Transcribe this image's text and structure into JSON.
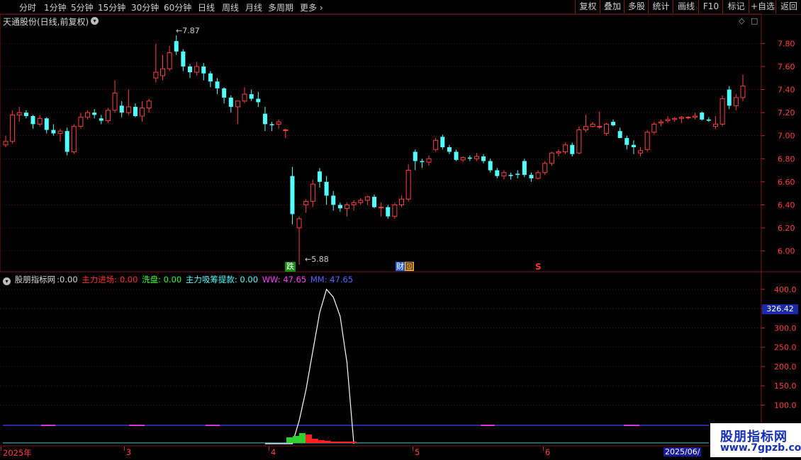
{
  "toolbar": {
    "periods": [
      "分时",
      "1分钟",
      "5分钟",
      "15分钟",
      "30分钟",
      "60分钟",
      "日线",
      "周线",
      "月线",
      "多周期",
      "更多"
    ],
    "more_icon": "chevron-right-icon",
    "buttons": [
      "复权",
      "叠加",
      "多股",
      "统计",
      "画线",
      "F10",
      "标记",
      "+自选",
      "返回"
    ]
  },
  "stock": {
    "title": "天通股份(日线,前复权)"
  },
  "price_axis": {
    "ticks": [
      "7.80",
      "7.60",
      "7.40",
      "7.20",
      "7.00",
      "6.80",
      "6.60",
      "6.40",
      "6.20",
      "6.00"
    ]
  },
  "annotations": {
    "high": "7.87",
    "low": "5.88"
  },
  "markers": {
    "die": "跌",
    "cai": "财",
    "hui": "回",
    "s": "S"
  },
  "indicator": {
    "name": "股朋指标网",
    "main_label": ":0.00",
    "zljc": "主力进场: 0.00",
    "xp": "洗盘: 0.00",
    "zltk": "主力吸筹提款: 0.00",
    "ww": "WW: 47.65",
    "mm": "MM: 47.65"
  },
  "ind_axis": {
    "ticks": [
      "400.0",
      "350.0",
      "300.0",
      "250.0",
      "200.0",
      "150.0",
      "100.0"
    ],
    "current": "326.42"
  },
  "x_axis": {
    "labels": [
      "2025年",
      "3",
      "4",
      "5",
      "6"
    ],
    "current_date": "2025/06/"
  },
  "watermark": {
    "main": "股朋指标网",
    "url": "www.7gpzb.com"
  },
  "colors": {
    "up": "#ff4040",
    "down": "#54ffff",
    "grid": "#7a1a1a",
    "ww": "#ff40ff",
    "mm": "#4040ff"
  },
  "chart_data": {
    "type": "candlestick",
    "ohlc": [
      [
        6.92,
        7.0,
        6.9,
        6.95
      ],
      [
        6.95,
        7.22,
        6.93,
        7.18
      ],
      [
        7.18,
        7.25,
        7.12,
        7.2
      ],
      [
        7.2,
        7.22,
        7.15,
        7.17
      ],
      [
        7.17,
        7.18,
        7.06,
        7.1
      ],
      [
        7.1,
        7.18,
        7.08,
        7.15
      ],
      [
        7.15,
        7.16,
        7.02,
        7.05
      ],
      [
        7.05,
        7.1,
        7.0,
        7.02
      ],
      [
        7.02,
        7.06,
        6.95,
        7.04
      ],
      [
        7.04,
        7.07,
        6.83,
        6.86
      ],
      [
        6.86,
        7.1,
        6.84,
        7.08
      ],
      [
        7.08,
        7.2,
        7.06,
        7.16
      ],
      [
        7.16,
        7.22,
        7.14,
        7.2
      ],
      [
        7.2,
        7.23,
        7.15,
        7.18
      ],
      [
        7.15,
        7.18,
        7.1,
        7.13
      ],
      [
        7.13,
        7.24,
        7.11,
        7.22
      ],
      [
        7.22,
        7.48,
        7.2,
        7.37
      ],
      [
        7.26,
        7.3,
        7.16,
        7.2
      ],
      [
        7.2,
        7.4,
        7.18,
        7.25
      ],
      [
        7.25,
        7.28,
        7.16,
        7.17
      ],
      [
        7.17,
        7.3,
        7.12,
        7.24
      ],
      [
        7.24,
        7.32,
        7.2,
        7.3
      ],
      [
        7.5,
        7.8,
        7.46,
        7.55
      ],
      [
        7.52,
        7.7,
        7.48,
        7.58
      ],
      [
        7.58,
        7.78,
        7.56,
        7.72
      ],
      [
        7.82,
        7.87,
        7.7,
        7.73
      ],
      [
        7.73,
        7.75,
        7.56,
        7.6
      ],
      [
        7.6,
        7.62,
        7.5,
        7.55
      ],
      [
        7.55,
        7.64,
        7.52,
        7.6
      ],
      [
        7.6,
        7.63,
        7.48,
        7.54
      ],
      [
        7.54,
        7.56,
        7.42,
        7.47
      ],
      [
        7.47,
        7.5,
        7.36,
        7.41
      ],
      [
        7.41,
        7.42,
        7.28,
        7.33
      ],
      [
        7.33,
        7.35,
        7.2,
        7.25
      ],
      [
        7.25,
        7.28,
        7.1,
        7.3
      ],
      [
        7.3,
        7.42,
        7.28,
        7.36
      ],
      [
        7.36,
        7.4,
        7.3,
        7.32
      ],
      [
        7.32,
        7.38,
        7.25,
        7.29
      ],
      [
        7.19,
        7.25,
        7.04,
        7.1
      ],
      [
        7.1,
        7.12,
        7.04,
        7.09
      ],
      [
        7.1,
        7.14,
        7.06,
        7.12
      ],
      [
        7.05,
        7.06,
        6.98,
        7.05
      ],
      [
        6.65,
        6.73,
        6.23,
        6.32
      ],
      [
        6.2,
        6.3,
        5.88,
        6.28
      ],
      [
        6.4,
        6.45,
        6.33,
        6.43
      ],
      [
        6.43,
        6.62,
        6.38,
        6.58
      ],
      [
        6.69,
        6.72,
        6.55,
        6.6
      ],
      [
        6.6,
        6.65,
        6.4,
        6.48
      ],
      [
        6.48,
        6.52,
        6.35,
        6.4
      ],
      [
        6.4,
        6.42,
        6.34,
        6.37
      ],
      [
        6.37,
        6.42,
        6.3,
        6.4
      ],
      [
        6.4,
        6.44,
        6.35,
        6.42
      ],
      [
        6.42,
        6.46,
        6.4,
        6.44
      ],
      [
        6.44,
        6.48,
        6.4,
        6.47
      ],
      [
        6.47,
        6.49,
        6.37,
        6.38
      ],
      [
        6.38,
        6.42,
        6.3,
        6.38
      ],
      [
        6.38,
        6.4,
        6.28,
        6.3
      ],
      [
        6.3,
        6.42,
        6.28,
        6.4
      ],
      [
        6.4,
        6.48,
        6.38,
        6.45
      ],
      [
        6.45,
        6.75,
        6.43,
        6.7
      ],
      [
        6.86,
        6.88,
        6.7,
        6.78
      ],
      [
        6.78,
        6.8,
        6.72,
        6.77
      ],
      [
        6.77,
        6.83,
        6.74,
        6.8
      ],
      [
        6.88,
        6.98,
        6.86,
        6.96
      ],
      [
        6.99,
        7.01,
        6.88,
        6.9
      ],
      [
        6.9,
        6.92,
        6.84,
        6.86
      ],
      [
        6.86,
        6.88,
        6.78,
        6.79
      ],
      [
        6.79,
        6.82,
        6.77,
        6.81
      ],
      [
        6.81,
        6.83,
        6.78,
        6.8
      ],
      [
        6.8,
        6.85,
        6.78,
        6.82
      ],
      [
        6.82,
        6.84,
        6.76,
        6.78
      ],
      [
        6.78,
        6.8,
        6.68,
        6.7
      ],
      [
        6.7,
        6.72,
        6.63,
        6.65
      ],
      [
        6.65,
        6.7,
        6.62,
        6.68
      ],
      [
        6.66,
        6.68,
        6.62,
        6.65
      ],
      [
        6.67,
        6.7,
        6.63,
        6.66
      ],
      [
        6.78,
        6.8,
        6.64,
        6.66
      ],
      [
        6.66,
        6.68,
        6.6,
        6.63
      ],
      [
        6.63,
        6.7,
        6.62,
        6.68
      ],
      [
        6.68,
        6.78,
        6.66,
        6.76
      ],
      [
        6.76,
        6.86,
        6.74,
        6.85
      ],
      [
        6.85,
        6.88,
        6.82,
        6.86
      ],
      [
        6.86,
        6.94,
        6.84,
        6.92
      ],
      [
        6.92,
        6.94,
        6.82,
        6.84
      ],
      [
        6.85,
        7.08,
        6.84,
        7.05
      ],
      [
        7.05,
        7.18,
        7.03,
        7.08
      ],
      [
        7.08,
        7.12,
        7.07,
        7.1
      ],
      [
        7.08,
        7.21,
        7.06,
        7.08
      ],
      [
        7.02,
        7.11,
        7.0,
        7.1
      ],
      [
        7.12,
        7.14,
        7.08,
        7.09
      ],
      [
        7.04,
        7.07,
        6.98,
        6.98
      ],
      [
        6.98,
        7.0,
        6.88,
        6.92
      ],
      [
        6.92,
        6.96,
        6.84,
        6.9
      ],
      [
        6.85,
        6.9,
        6.82,
        6.87
      ],
      [
        6.88,
        7.05,
        6.86,
        7.03
      ],
      [
        7.03,
        7.12,
        7.01,
        7.1
      ],
      [
        7.11,
        7.14,
        7.08,
        7.12
      ],
      [
        7.13,
        7.17,
        7.11,
        7.14
      ],
      [
        7.14,
        7.16,
        7.12,
        7.15
      ],
      [
        7.15,
        7.17,
        7.11,
        7.16
      ],
      [
        7.16,
        7.17,
        7.14,
        7.16
      ],
      [
        7.16,
        7.2,
        7.14,
        7.17
      ],
      [
        7.2,
        7.21,
        7.13,
        7.14
      ],
      [
        7.14,
        7.16,
        7.12,
        7.13
      ],
      [
        7.08,
        7.17,
        7.06,
        7.1
      ],
      [
        7.1,
        7.35,
        7.08,
        7.32
      ],
      [
        7.4,
        7.43,
        7.23,
        7.26
      ],
      [
        7.26,
        7.36,
        7.22,
        7.33
      ],
      [
        7.33,
        7.53,
        7.3,
        7.43
      ]
    ],
    "indicator_series": {
      "line_white": [
        0,
        0,
        0,
        0,
        0,
        60,
        140,
        240,
        340,
        400,
        380,
        330,
        210,
        0
      ],
      "line_start_index": 38
    }
  }
}
